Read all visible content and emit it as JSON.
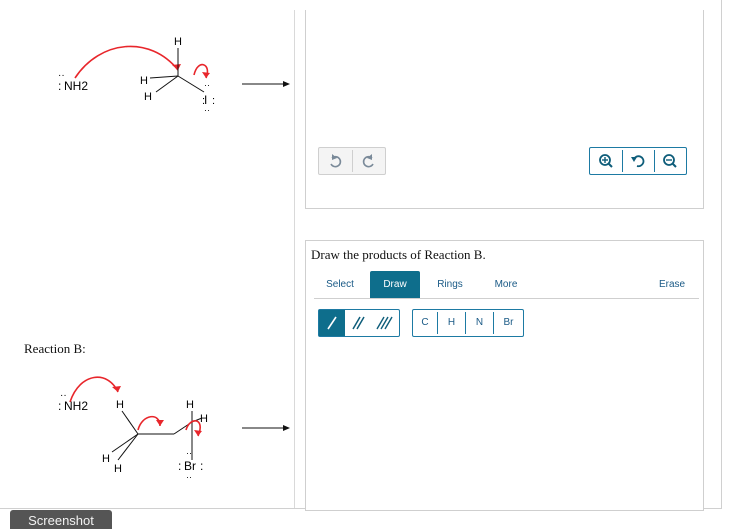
{
  "reaction_a": {
    "nucleophile": "NH2",
    "h_top": "H",
    "h_left": "H",
    "h_left_lower": "H",
    "leaving_atom": "I"
  },
  "reaction_b": {
    "label": "Reaction B:",
    "nucleophile": "NH2",
    "h_top_left": "H",
    "h_top_right": "H",
    "h_right": "H",
    "h_bottom_left": "H",
    "h_bottom": "H",
    "leaving_group": "Br"
  },
  "panel_a": {
    "undo_icon": "undo-icon",
    "redo_icon": "redo-icon",
    "zoom_in_icon": "zoom-in-icon",
    "reset_icon": "reset-icon",
    "zoom_out_icon": "zoom-out-icon"
  },
  "panel_b": {
    "prompt": "Draw the products of Reaction B.",
    "tabs": [
      "Select",
      "Draw",
      "Rings",
      "More",
      "Erase"
    ],
    "active_tab": "Draw",
    "bond_tools": [
      "single-bond-icon",
      "double-bond-icon",
      "triple-bond-icon"
    ],
    "atoms": [
      "C",
      "H",
      "N",
      "Br"
    ]
  },
  "screenshot_button": "Screenshot",
  "colors": {
    "accent": "#0e6e8c",
    "arrow_red": "#e8262b",
    "border": "#1d7aa3"
  }
}
